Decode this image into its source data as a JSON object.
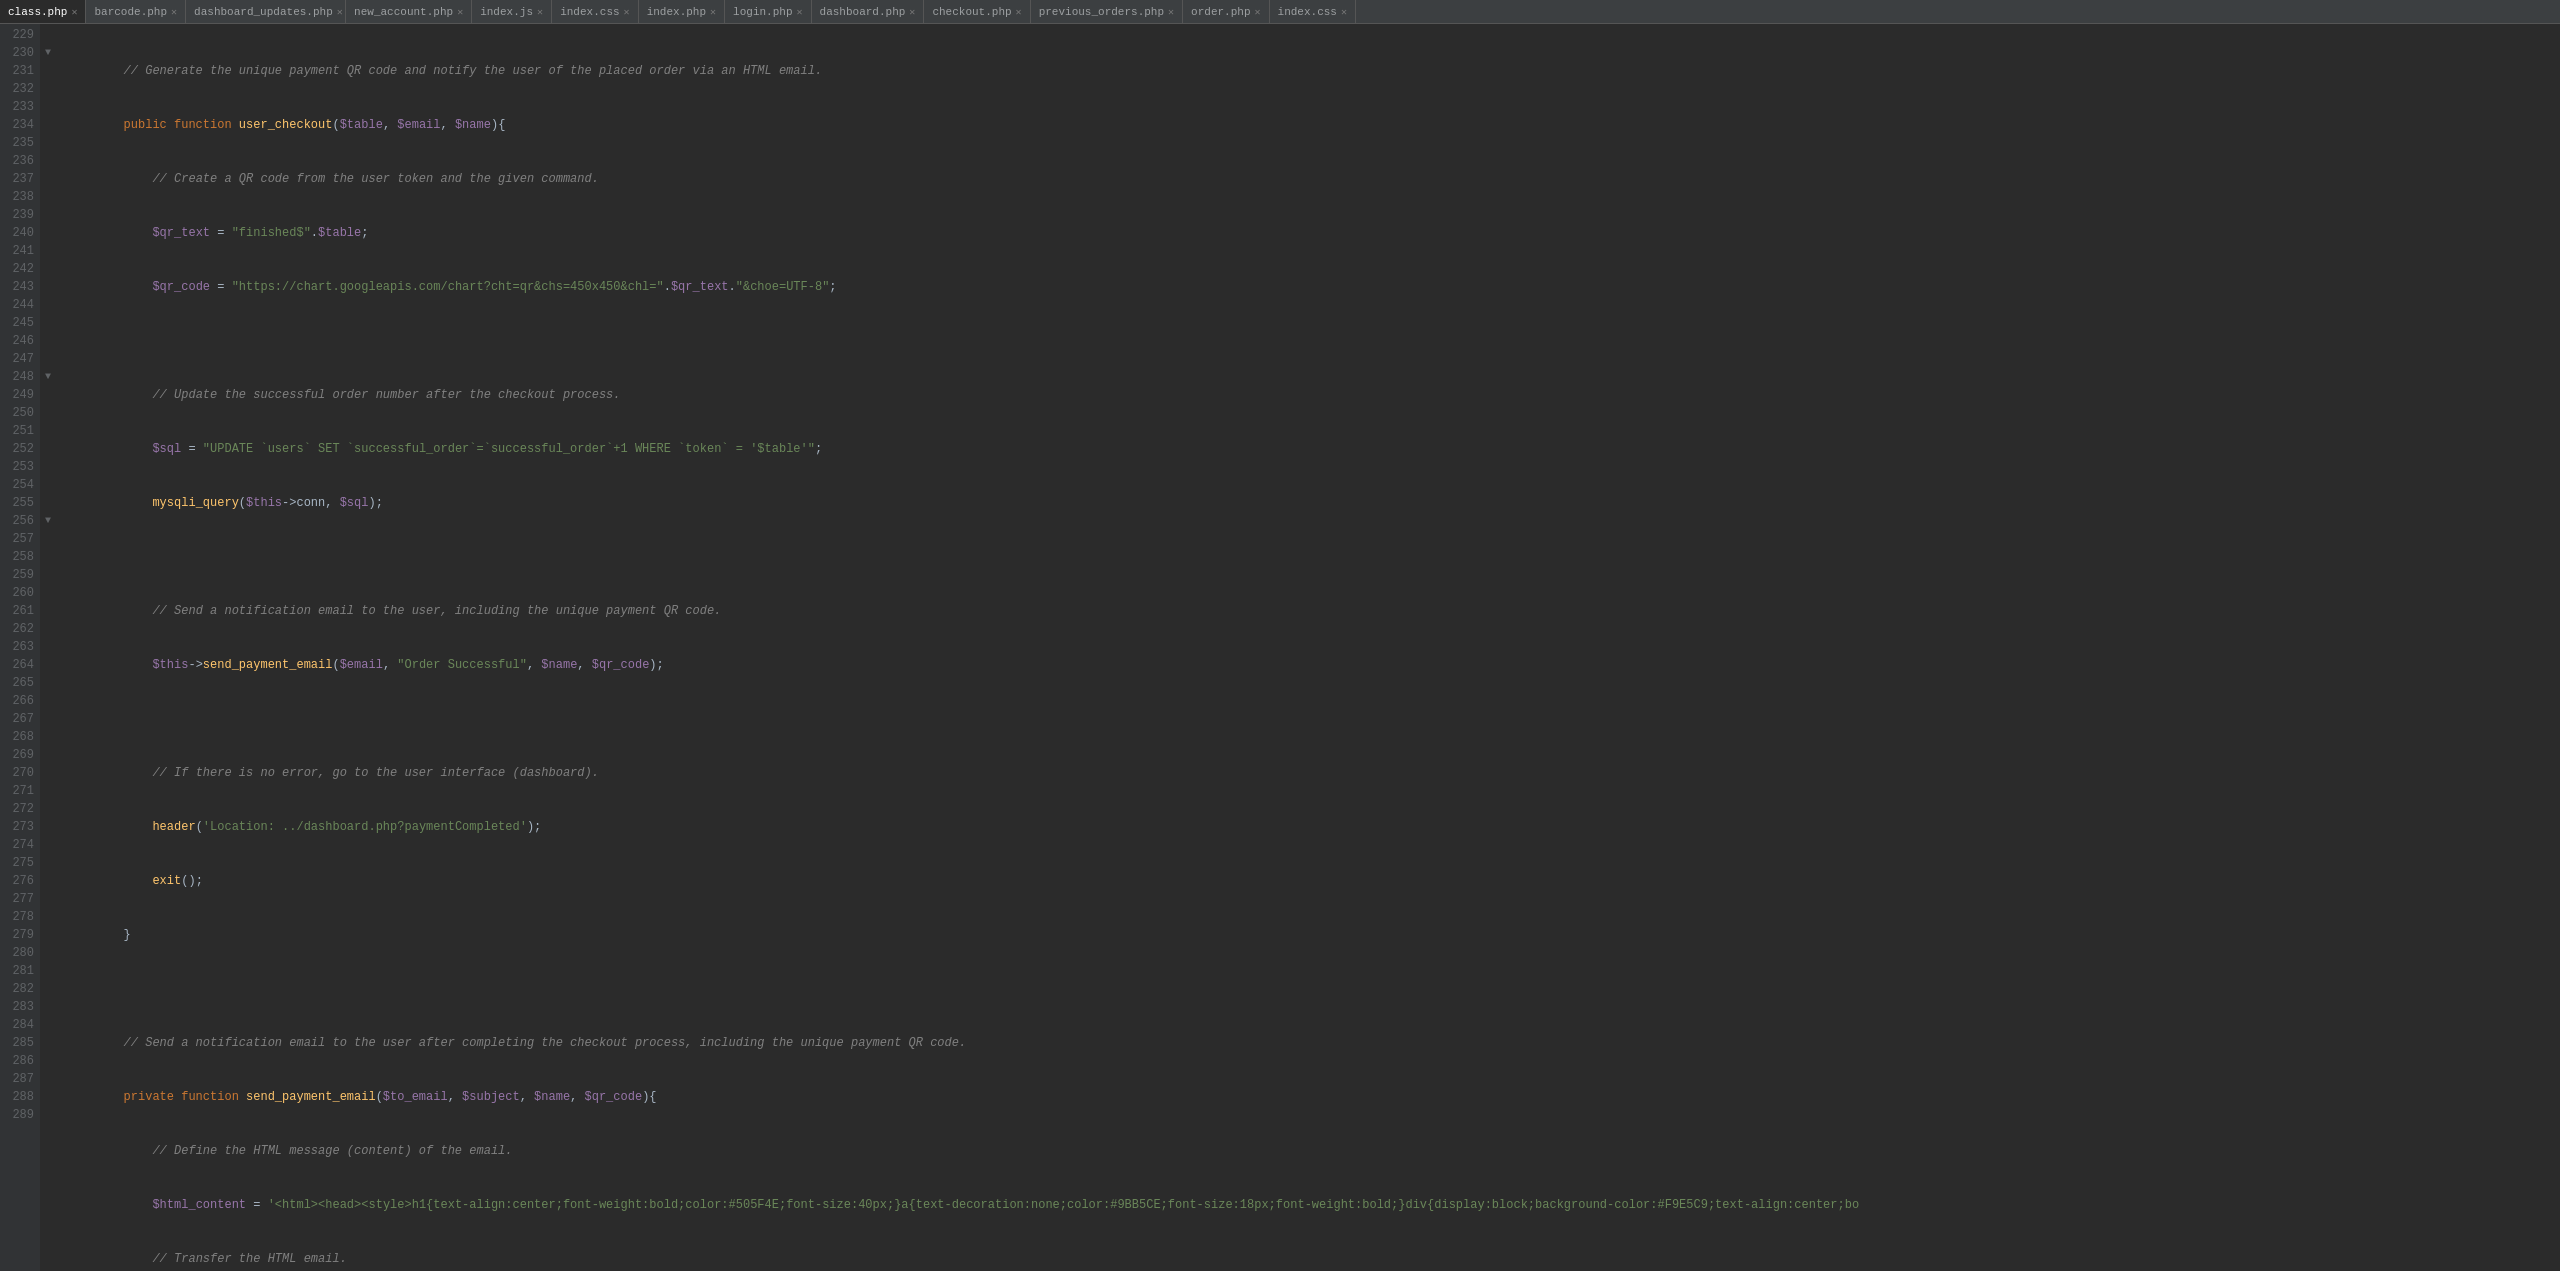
{
  "tabs": [
    {
      "label": "class.php",
      "active": true,
      "id": "class-php"
    },
    {
      "label": "barcode.php",
      "active": false,
      "id": "barcode-php"
    },
    {
      "label": "dashboard_updates.php",
      "active": false,
      "id": "dashboard-updates-php"
    },
    {
      "label": "new_account.php",
      "active": false,
      "id": "new-account-php"
    },
    {
      "label": "index.js",
      "active": false,
      "id": "index-js"
    },
    {
      "label": "index.css",
      "active": false,
      "id": "index-css"
    },
    {
      "label": "index.php",
      "active": false,
      "id": "index-php"
    },
    {
      "label": "login.php",
      "active": false,
      "id": "login-php"
    },
    {
      "label": "dashboard.php",
      "active": false,
      "id": "dashboard-php"
    },
    {
      "label": "checkout.php",
      "active": false,
      "id": "checkout-php"
    },
    {
      "label": "previous_orders.php",
      "active": false,
      "id": "previous-orders-php"
    },
    {
      "label": "order.php",
      "active": false,
      "id": "order-php"
    },
    {
      "label": "index.css",
      "active": false,
      "id": "index-css-2"
    }
  ],
  "startLine": 229,
  "colors": {
    "background": "#2b2b2b",
    "lineNumbers": "#606366",
    "gutterBg": "#313335",
    "activeTab": "#2b2b2b",
    "inactiveTab": "#3c3f41"
  }
}
